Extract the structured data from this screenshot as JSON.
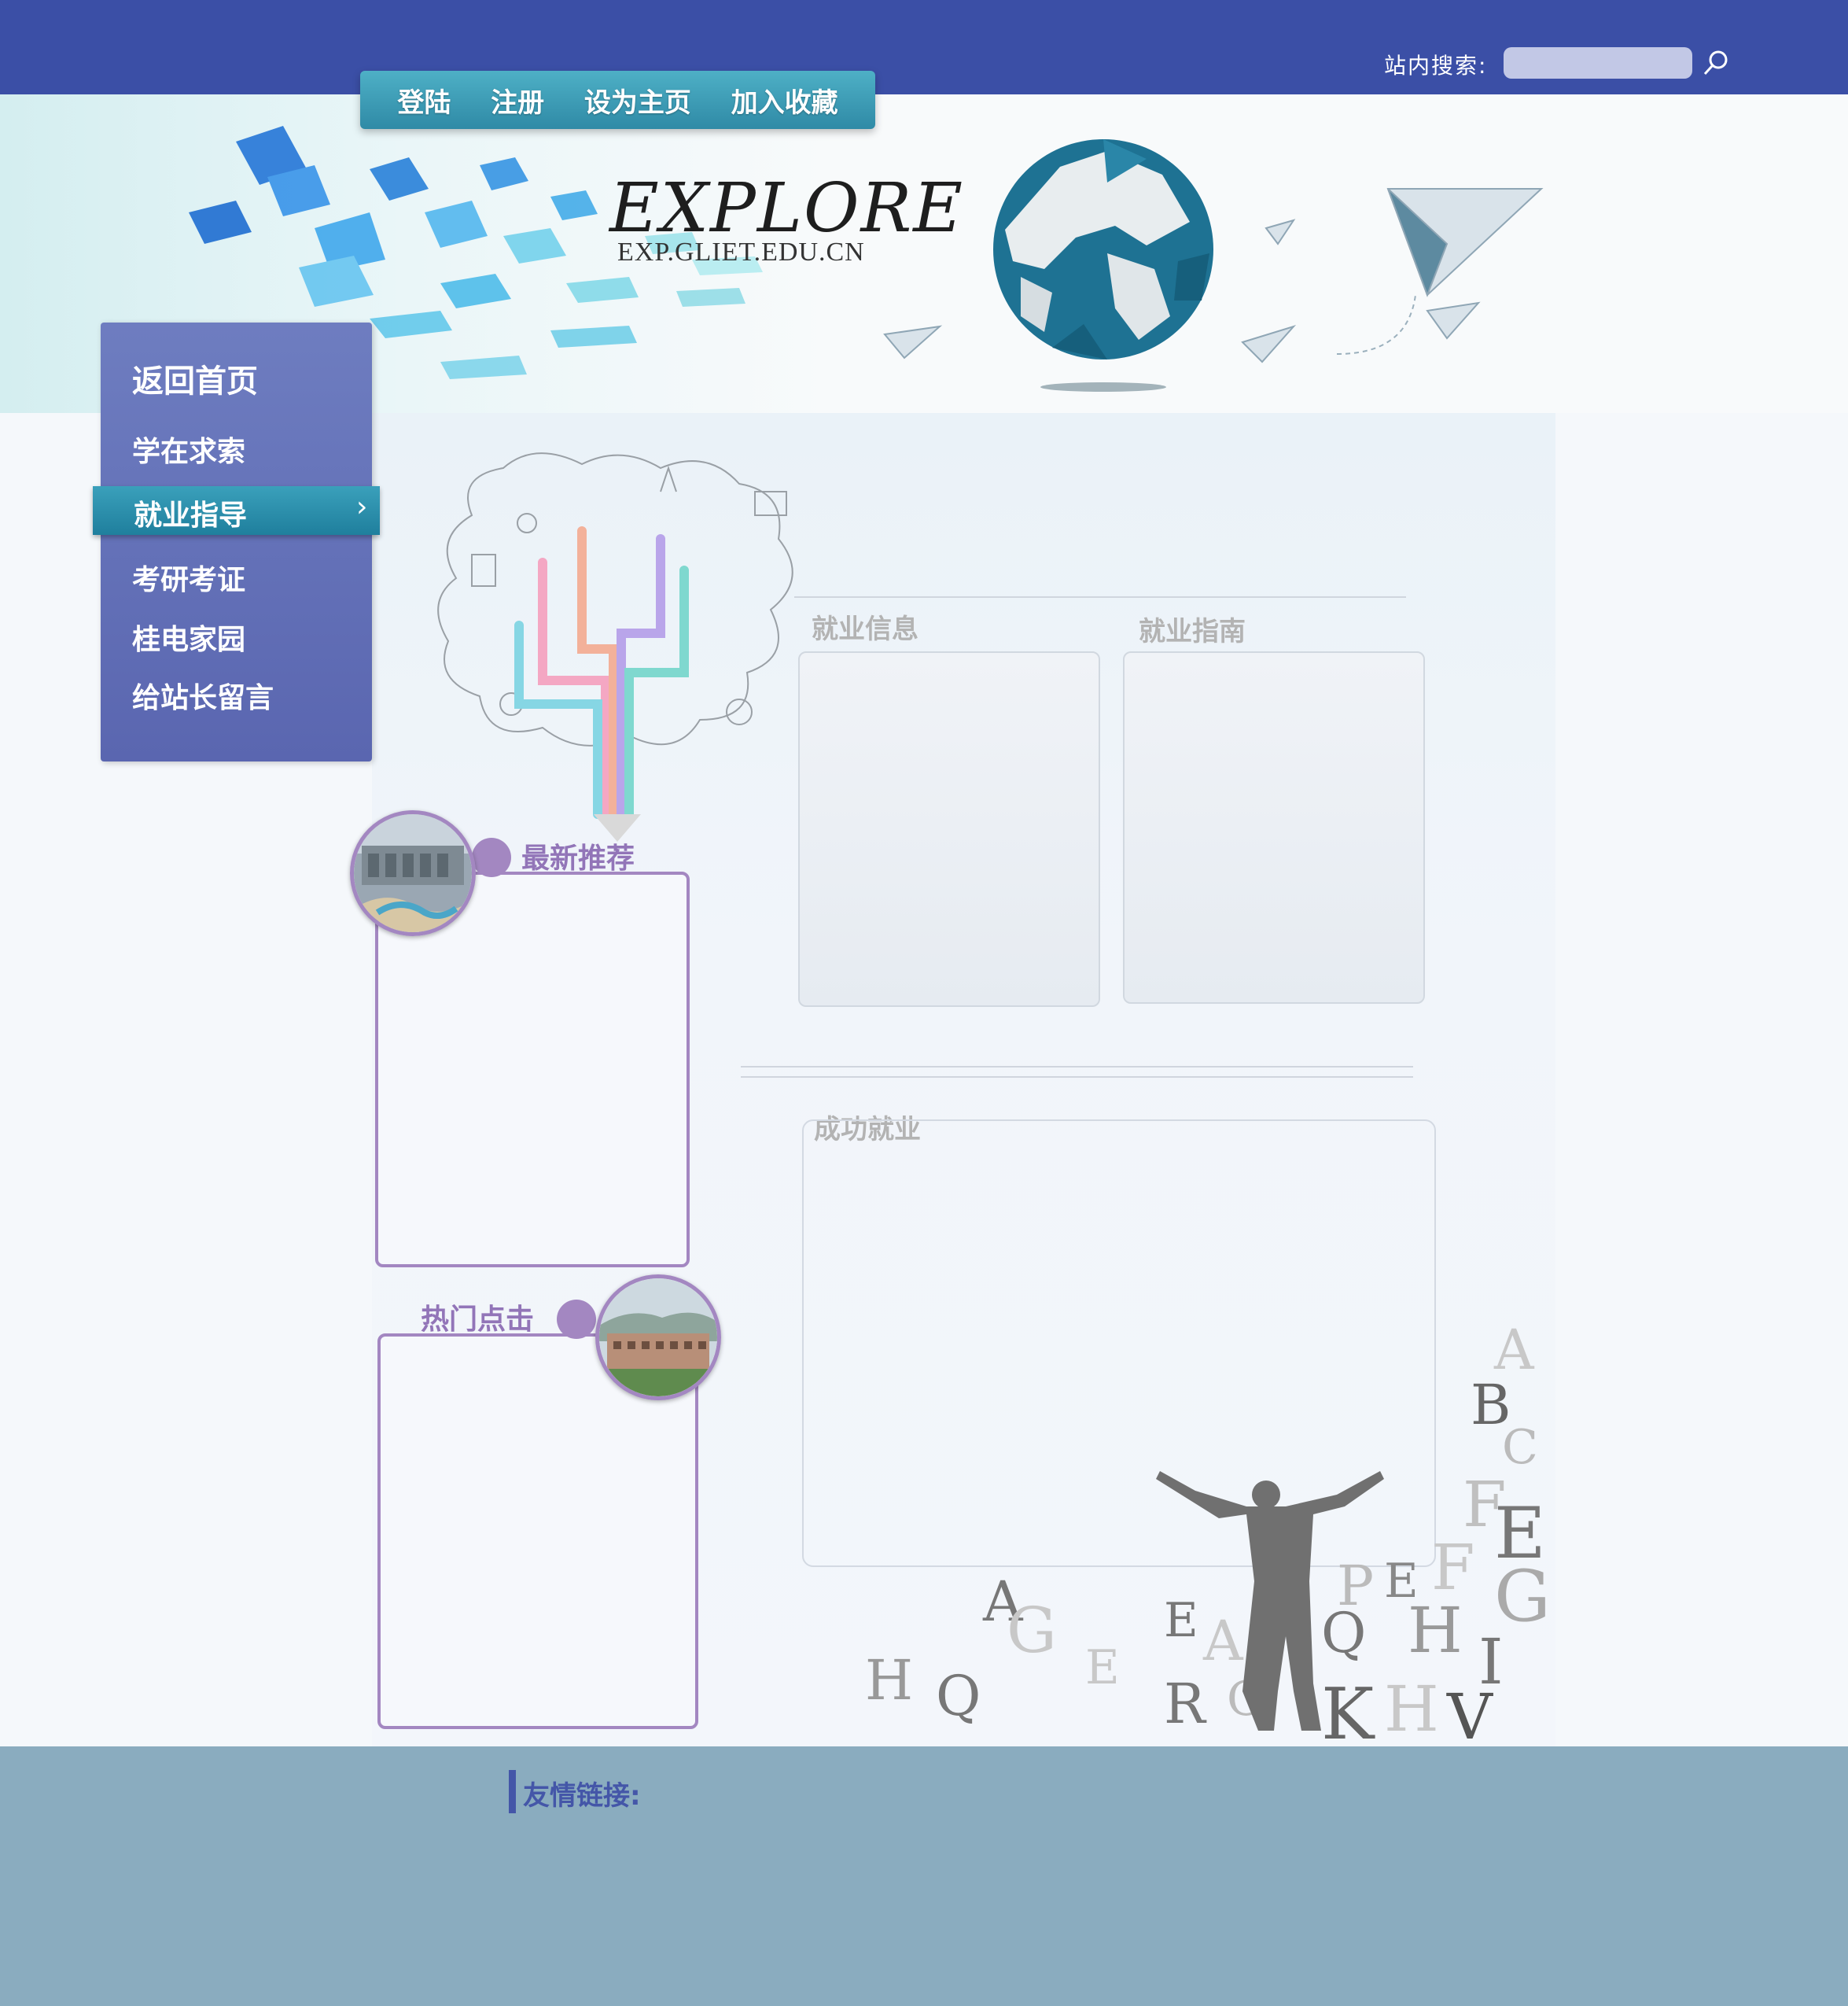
{
  "header": {
    "search_label": "站内搜索:",
    "search_placeholder": "",
    "search_icon": "search-icon"
  },
  "topnav": {
    "items": [
      "登陆",
      "注册",
      "设为主页",
      "加入收藏"
    ]
  },
  "banner": {
    "logo_title": "EXPLORE",
    "logo_domain": "EXP.GLIET.EDU.CN"
  },
  "sidebar": {
    "items": [
      {
        "label": "返回首页",
        "active": false
      },
      {
        "label": "学在求索",
        "active": false
      },
      {
        "label": "就业指导",
        "active": true
      },
      {
        "label": "考研考证",
        "active": false
      },
      {
        "label": "桂电家园",
        "active": false
      },
      {
        "label": "给站长留言",
        "active": false
      }
    ],
    "active_arrow": "›"
  },
  "main": {
    "section_jobinfo": "就业信息",
    "section_guide": "就业指南",
    "section_success": "成功就业"
  },
  "left_boxes": {
    "latest": "最新推荐",
    "hot": "热门点击"
  },
  "footer": {
    "links_label": "友情链接:"
  },
  "colors": {
    "top_bar": "#3b4fa6",
    "nav": "#2f8aa6",
    "sidebar": "#5a66b0",
    "accent_purple": "#a387c1",
    "footer": "#8aacbf"
  }
}
